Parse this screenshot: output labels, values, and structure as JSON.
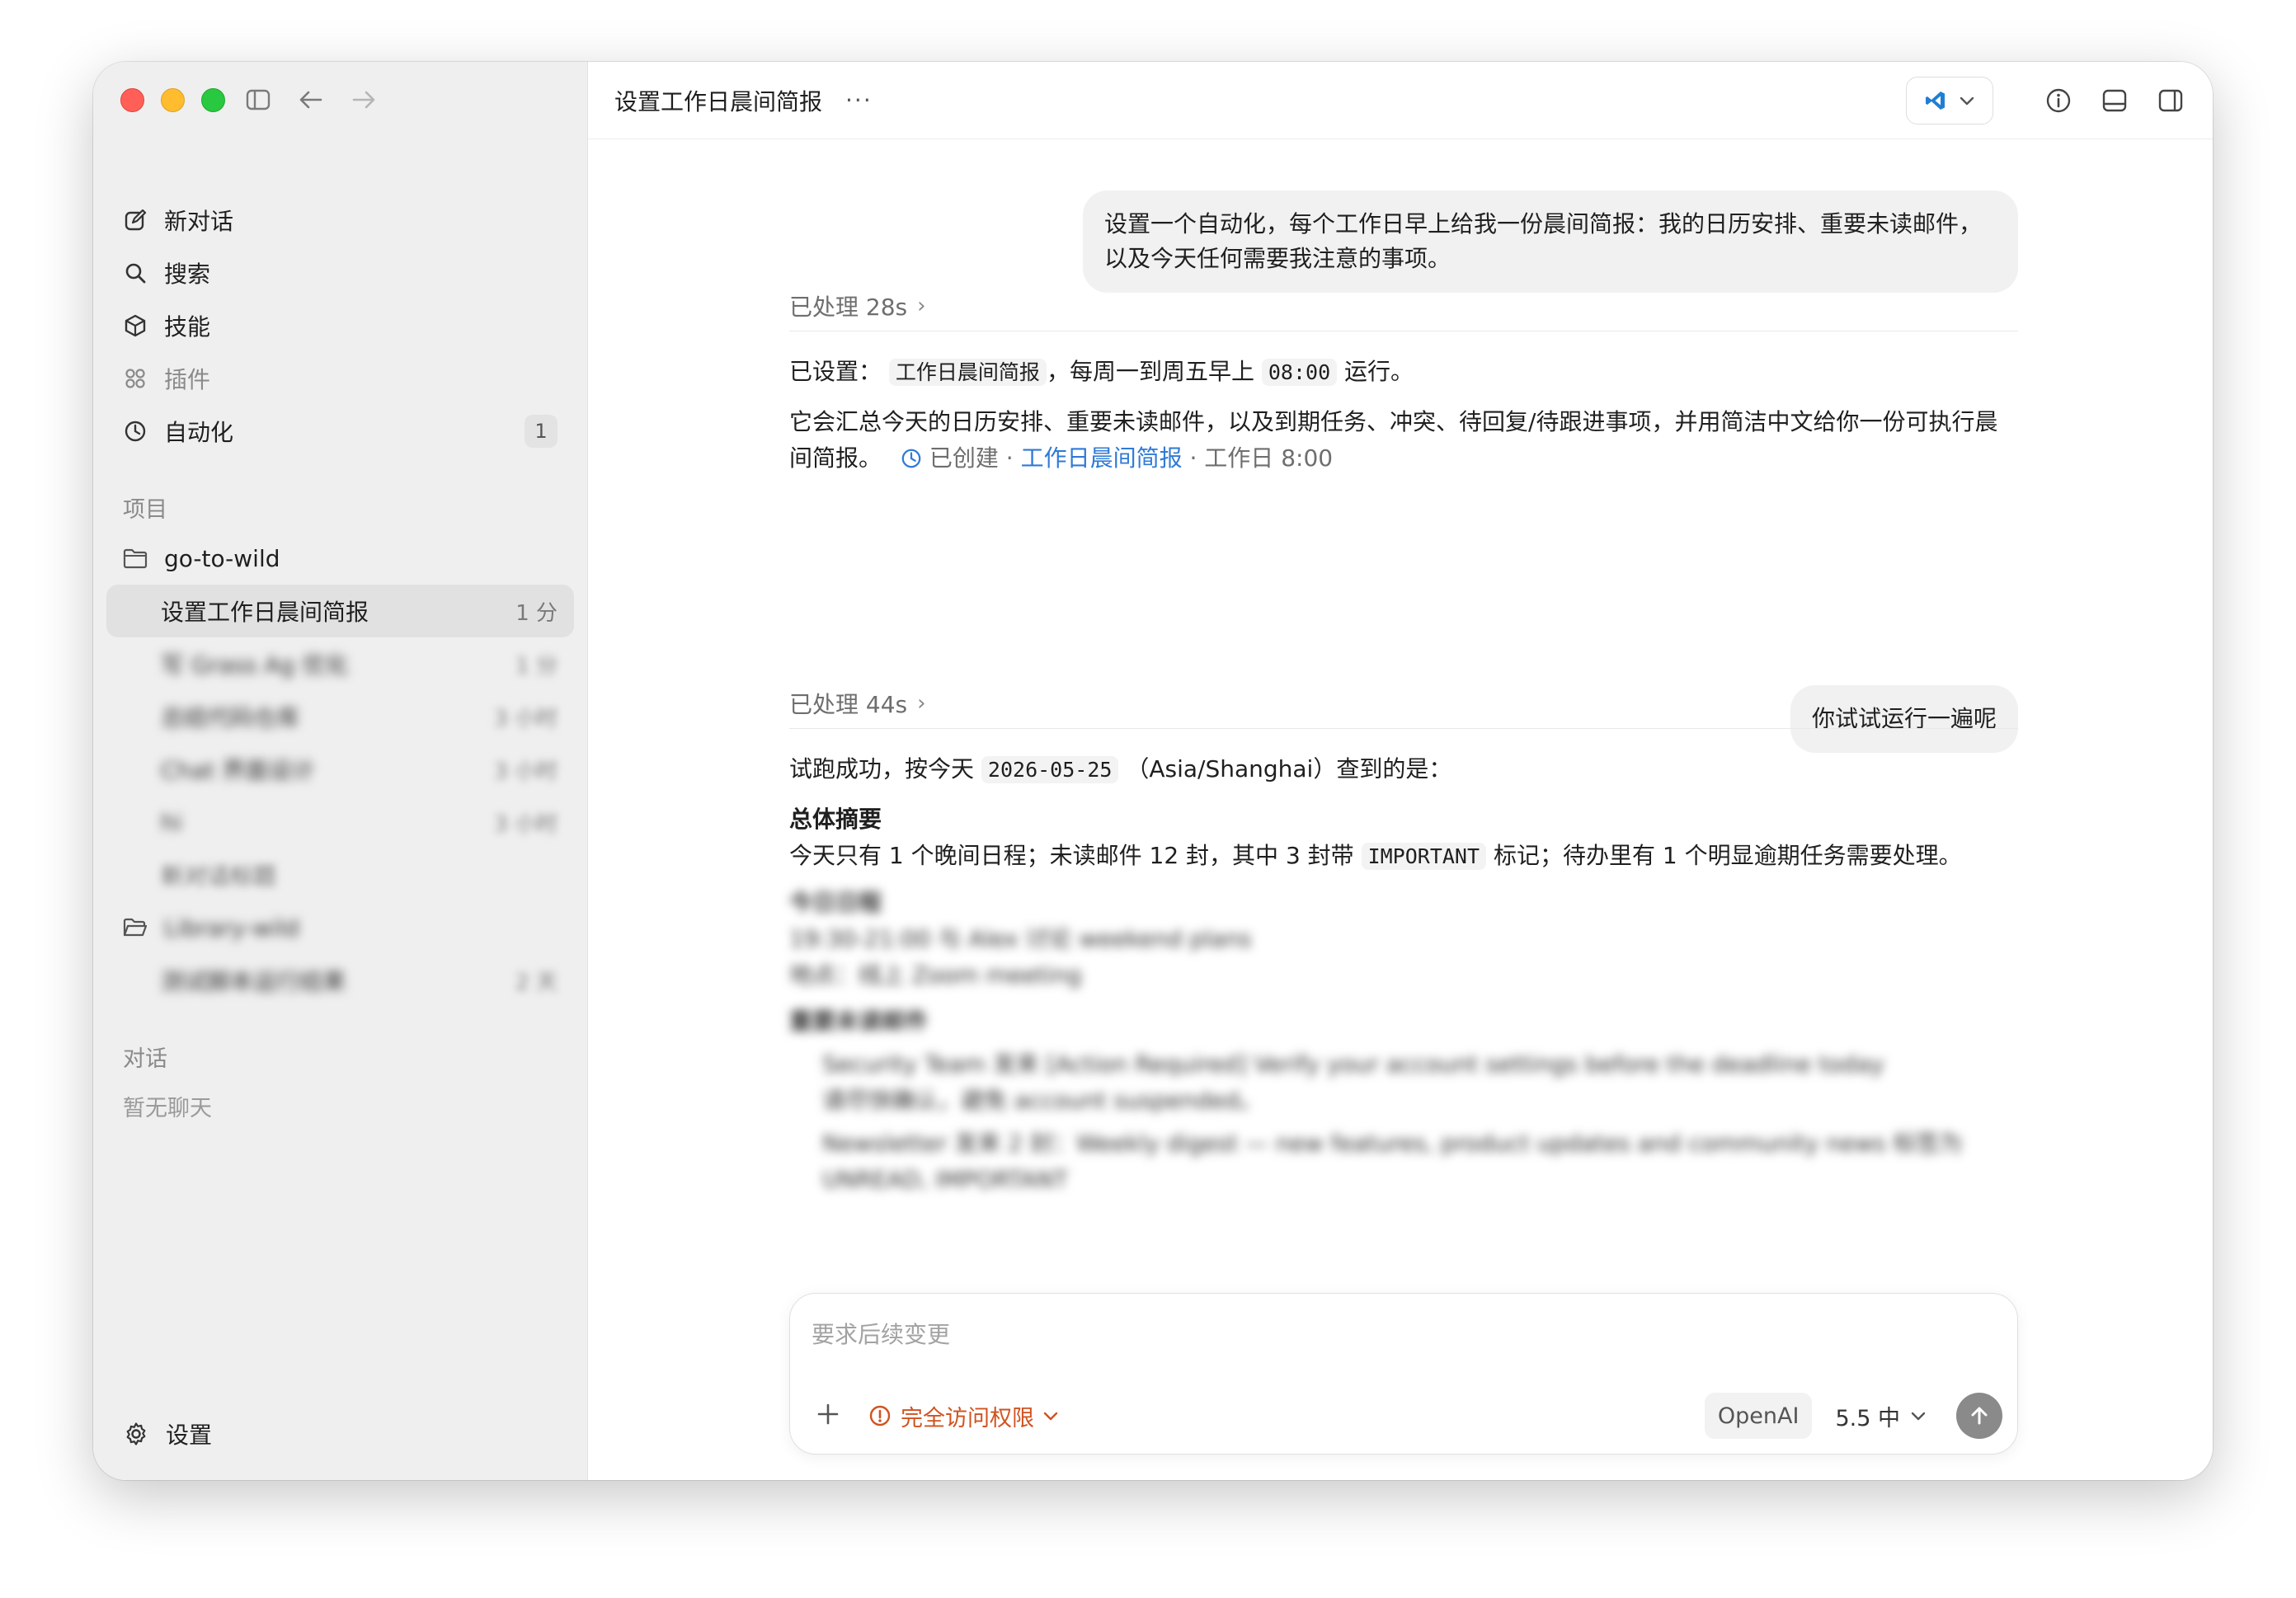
{
  "sidebar": {
    "nav": [
      {
        "label": "新对话",
        "icon": "edit-icon"
      },
      {
        "label": "搜索",
        "icon": "search-icon"
      },
      {
        "label": "技能",
        "icon": "cube-icon"
      },
      {
        "label": "插件",
        "icon": "grid-icon"
      },
      {
        "label": "自动化",
        "icon": "clock-icon",
        "badge": "1"
      }
    ],
    "projects_label": "项目",
    "projects": [
      {
        "name": "go-to-wild",
        "threads": [
          {
            "title": "设置工作日晨间简报",
            "time": "1 分",
            "active": true
          },
          {
            "title": "写 Grass Ag 优化",
            "time": "1 分"
          },
          {
            "title": "总结代码仓库",
            "time": "3 小时"
          },
          {
            "title": "Chat 界面设计",
            "time": "3 小时"
          },
          {
            "title": "hi",
            "time": "3 小时"
          },
          {
            "title": "新对话标题",
            "time": ""
          }
        ]
      },
      {
        "name": "Library-wild",
        "threads": [
          {
            "title": "测试脚本运行结果",
            "time": "2 天"
          }
        ]
      }
    ],
    "chats_label": "对话",
    "chats_empty": "暂无聊天",
    "settings_label": "设置"
  },
  "header": {
    "title": "设置工作日晨间简报",
    "more": "···"
  },
  "conversation": {
    "user_msg_1": [
      "设置一个自动化，每个工作日早上给我一份晨间简报：我的日历安排、重要未读邮件，",
      "以及今天任何需要我注意的事项。"
    ],
    "processed_1": "已处理 28s",
    "reply_1": {
      "prefix": "已设置：",
      "name_code": "工作日晨间简报",
      "mid": "，每周一到周五早上",
      "time_code": "08:00",
      "suffix": "运行。",
      "line2": "它会汇总今天的日历安排、重要未读邮件，以及到期任务、冲突、待回复/待跟进事项，并用简洁中文给你一份可执行晨",
      "line3": "间简报。",
      "created": "已创建",
      "dot": "·",
      "automation_link": "工作日晨间简报",
      "schedule": "工作日 8:00"
    },
    "user_msg_2": "你试试运行一遍呢",
    "processed_2": "已处理 44s",
    "reply_2": {
      "line1_prefix": "试跑成功，按今天",
      "date_code": "2026-05-25",
      "line1_suffix": "（Asia/Shanghai）查到的是：",
      "summary_heading": "总体摘要",
      "summary_prefix": "今天只有 1 个晚间日程；未读邮件 12 封，其中 3 封带",
      "summary_code": "IMPORTANT",
      "summary_suffix": "标记；待办里有 1 个明显逾期任务需要处理。",
      "blur_h1": "今日日程",
      "blur_l1": "19:30-21:00 与 Alex 讨论 weekend plans",
      "blur_l2": "地点：线上 Zoom meeting",
      "blur_h2": "重要未读邮件",
      "blur_b1a": "Security Team 发来 [Action Required] Verify your account settings before the deadline today",
      "blur_b1b": "请尽快确认，避免 account suspended。",
      "blur_b2a": "Newsletter 发来 2 封：Weekly digest — new features, product updates and community news 标签为",
      "blur_b2b": "UNREAD, IMPORTANT"
    }
  },
  "composer": {
    "placeholder": "要求后续变更",
    "access": "完全访问权限",
    "provider": "OpenAI",
    "model": "5.5 中"
  },
  "colors": {
    "accent_link": "#2f7ad6",
    "warning": "#d0531f",
    "sidebar_bg": "#efefef"
  }
}
